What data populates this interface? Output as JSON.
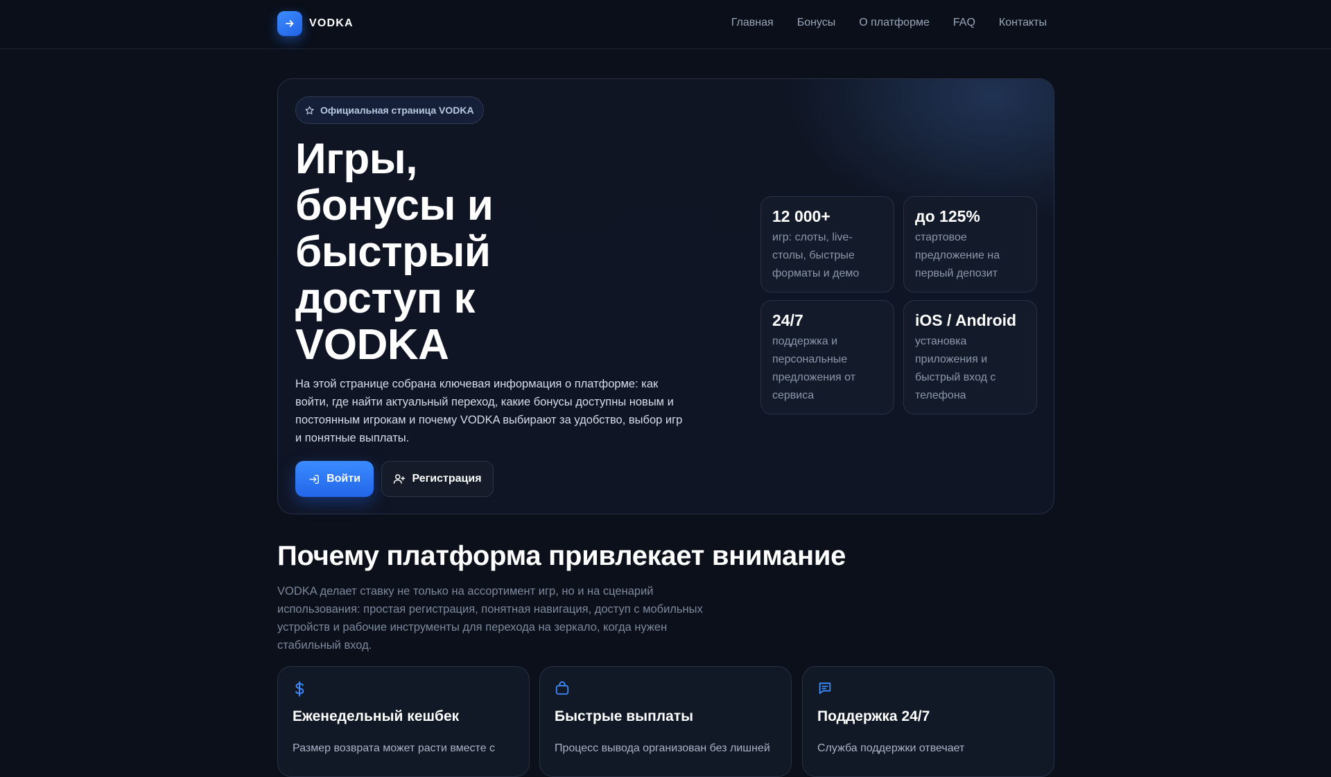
{
  "brand": {
    "name": "VODKA",
    "icon": "arrow-right-icon",
    "accent": "#2f78ff"
  },
  "nav": {
    "items": [
      "Главная",
      "Бонусы",
      "О платформе",
      "FAQ",
      "Контакты"
    ]
  },
  "hero": {
    "badge": "Официальная страница VODKA",
    "badge_icon": "star-icon",
    "title": "Игры, бонусы и быстрый доступ к VODKA",
    "description": "На этой странице собрана ключевая информация о платформе: как войти, где найти актуальный переход, какие бонусы доступны новым и постоянным игрокам и почему VODKA выбирают за удобство, выбор игр и понятные выплаты.",
    "login_label": "Войти",
    "register_label": "Регистрация"
  },
  "stats": [
    {
      "value": "12 000+",
      "desc": "игр: слоты, live-столы, быстрые форматы и демо"
    },
    {
      "value": "до 125%",
      "desc": "стартовое предложение на первый депозит"
    },
    {
      "value": "24/7",
      "desc": "поддержка и персональные предложения от сервиса"
    },
    {
      "value": "iOS / Android",
      "desc": "установка приложения и быстрый вход с телефона"
    }
  ],
  "why": {
    "title": "Почему платформа привлекает внимание",
    "description": "VODKA делает ставку не только на ассортимент игр, но и на сценарий использования: простая регистрация, понятная навигация, доступ с мобильных устройств и рабочие инструменты для перехода на зеркало, когда нужен стабильный вход."
  },
  "features": [
    {
      "icon": "dollar-icon",
      "title": "Еженедельный кешбек",
      "desc": "Размер возврата может расти вместе с"
    },
    {
      "icon": "bag-icon",
      "title": "Быстрые выплаты",
      "desc": "Процесс вывода организован без лишней"
    },
    {
      "icon": "chat-icon",
      "title": "Поддержка 24/7",
      "desc": "Служба поддержки отвечает"
    }
  ]
}
